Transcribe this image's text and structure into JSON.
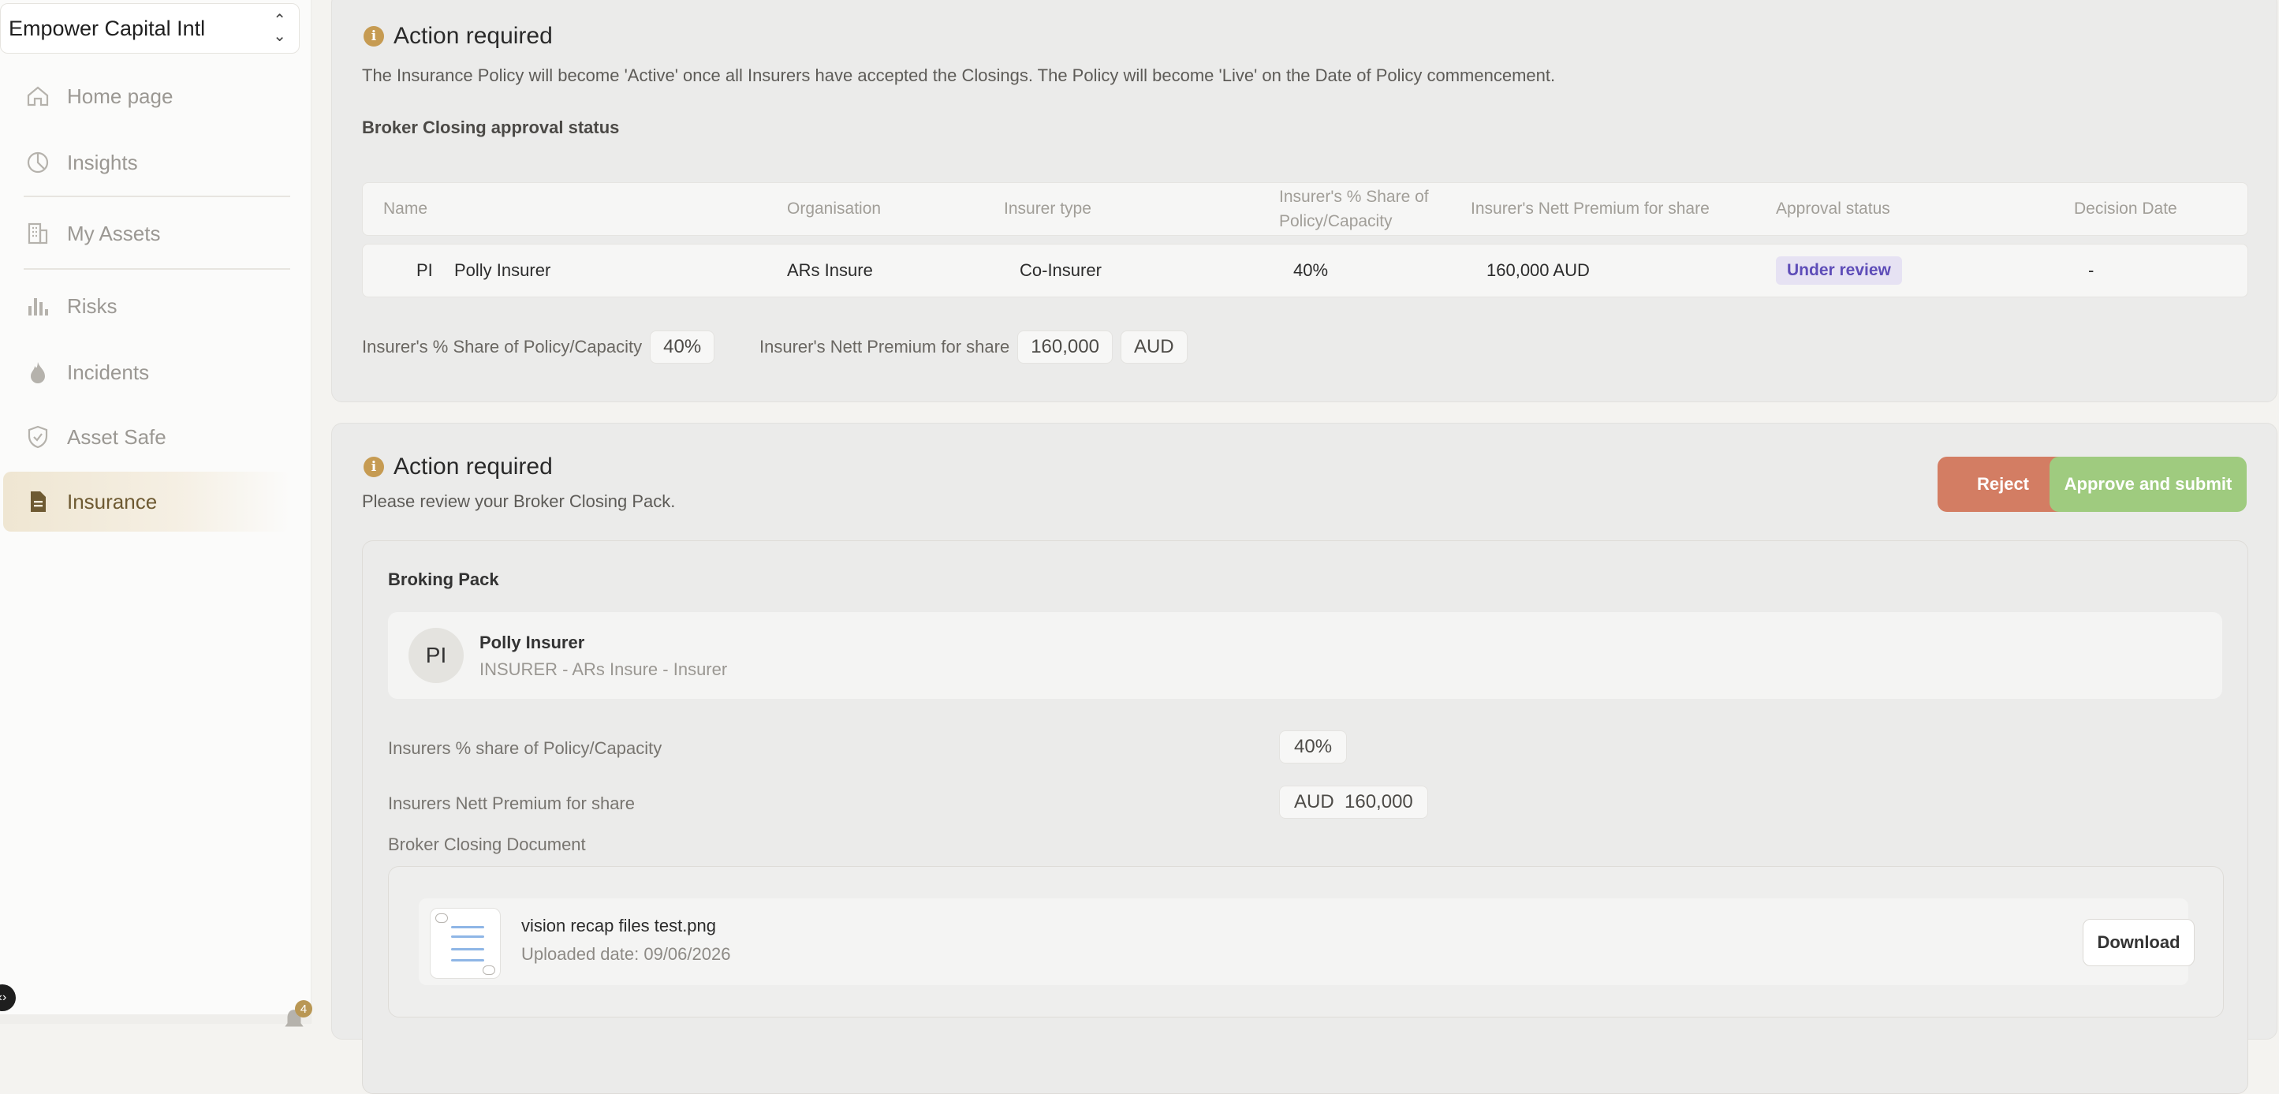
{
  "sidebar": {
    "org_name": "Empower Capital Intl",
    "items": [
      {
        "label": "Home page",
        "icon": "home-icon"
      },
      {
        "label": "Insights",
        "icon": "pie-chart-icon"
      },
      {
        "label": "My Assets",
        "icon": "building-icon"
      },
      {
        "label": "Risks",
        "icon": "bar-chart-icon"
      },
      {
        "label": "Incidents",
        "icon": "flame-icon"
      },
      {
        "label": "Asset Safe",
        "icon": "shield-icon"
      },
      {
        "label": "Insurance",
        "icon": "document-icon",
        "active": true
      }
    ],
    "notification_count": "4"
  },
  "status_card": {
    "title": "Action required",
    "description": "The Insurance Policy will become 'Active' once all Insurers have accepted the Closings. The Policy will become 'Live' on the Date of Policy commencement.",
    "subtitle": "Broker Closing approval status",
    "table": {
      "headers": {
        "name": "Name",
        "organisation": "Organisation",
        "insurer_type": "Insurer type",
        "share_line1": "Insurer's % Share of",
        "share_line2": "Policy/Capacity",
        "premium": "Insurer's Nett Premium for share",
        "approval": "Approval status",
        "decision": "Decision Date"
      },
      "row": {
        "initials": "PI",
        "name": "Polly Insurer",
        "organisation": "ARs Insure",
        "insurer_type": "Co-Insurer",
        "share": "40%",
        "premium": "160,000 AUD",
        "approval": "Under review",
        "decision": "-"
      }
    },
    "share_label": "Insurer's % Share of Policy/Capacity",
    "share_value": "40%",
    "premium_label": "Insurer's Nett Premium for share",
    "premium_value": "160,000",
    "premium_currency": "AUD"
  },
  "review_card": {
    "title": "Action required",
    "description": "Please review your Broker Closing Pack.",
    "reject_label": "Reject",
    "approve_label": "Approve and submit",
    "pack": {
      "title": "Broking Pack",
      "insurer_initials": "PI",
      "insurer_name": "Polly Insurer",
      "insurer_role": "INSURER - ARs Insure - Insurer",
      "share_label": "Insurers % share of Policy/Capacity",
      "share_value": "40%",
      "premium_label": "Insurers Nett Premium for share",
      "premium_value": "AUD  160,000",
      "doc_section_label": "Broker Closing Document",
      "doc_name": "vision recap files test.png",
      "doc_date": "Uploaded date: 09/06/2026",
      "download_label": "Download"
    }
  },
  "colors": {
    "accent": "#b99754",
    "reject": "#d37d63",
    "approve": "#9fcb7f",
    "status_pill_text": "#5e4db8",
    "status_pill_bg": "#e6e2f3"
  }
}
